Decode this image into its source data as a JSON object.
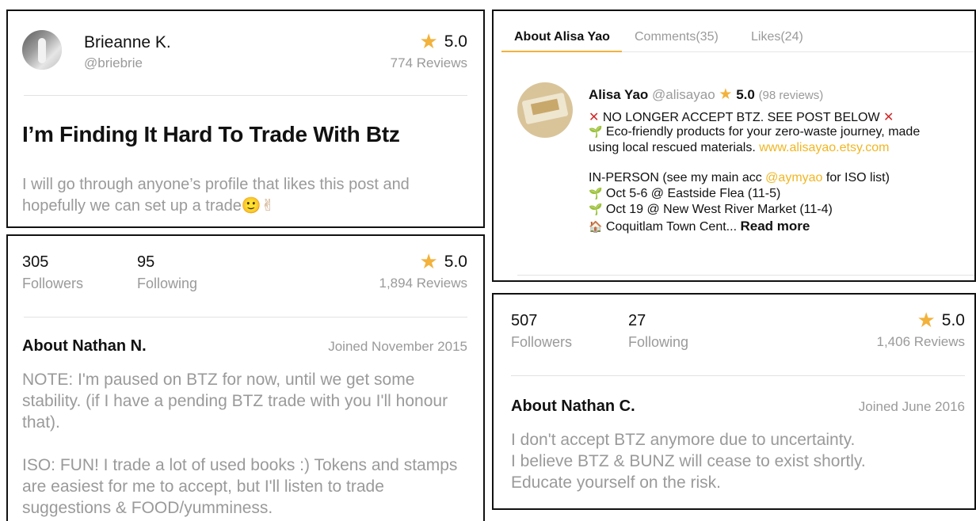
{
  "post": {
    "user_name": "Brieanne K.",
    "user_handle": "@briebrie",
    "rating": "5.0",
    "reviews": "774 Reviews",
    "title": "I’m Finding It Hard To Trade With Btz",
    "body": "I will go through anyone’s profile that likes this post and hopefully we can set up a trade",
    "emoji_1": "🙂",
    "emoji_2": "✌"
  },
  "profile_nathan_n": {
    "followers_count": "305",
    "followers_label": "Followers",
    "following_count": "95",
    "following_label": "Following",
    "rating": "5.0",
    "reviews": "1,894 Reviews",
    "about_title": "About Nathan N.",
    "joined": "Joined November 2015",
    "about_p1": "NOTE: I'm paused on BTZ for now, until we get some stability. (if I have a pending BTZ trade with you I'll honour that).",
    "about_p2": "ISO: FUN! I trade a lot of used books :) Tokens and stamps are easiest for me to accept, but I'll listen to trade suggestions & FOOD/yumminess."
  },
  "profile_alisa": {
    "tabs": [
      {
        "label": "About Alisa Yao"
      },
      {
        "label": "Comments(35)"
      },
      {
        "label": "Likes(24)"
      }
    ],
    "name": "Alisa Yao",
    "handle": "@alisayao",
    "rating": "5.0",
    "reviews": "(98 reviews)",
    "line_notice": "NO LONGER ACCEPT BTZ. SEE POST BELOW",
    "line_eco_1": "Eco-friendly products for your zero-waste journey, made",
    "line_eco_2": "using local rescued materials.",
    "site_link": "www.alisayao.etsy.com",
    "in_person_prefix": "IN-PERSON (see my main acc",
    "main_acc": "@aymyao",
    "in_person_suffix": "for ISO list)",
    "event_1": "Oct 5-6 @ Eastside Flea (11-5)",
    "event_2": "Oct 19 @ New West River Market (11-4)",
    "event_3": "Coquitlam Town Cent...",
    "read_more": "Read more",
    "icons": {
      "cross": "red-x-icon",
      "sprout": "seedling-icon",
      "house": "house-icon"
    }
  },
  "profile_nathan_c": {
    "followers_count": "507",
    "followers_label": "Followers",
    "following_count": "27",
    "following_label": "Following",
    "rating": "5.0",
    "reviews": "1,406 Reviews",
    "about_title": "About Nathan C.",
    "joined": "Joined June 2016",
    "about_l1": "I don't accept BTZ anymore due to uncertainty.",
    "about_l2": "I believe BTZ & BUNZ will cease to exist shortly.",
    "about_l3": "Educate yourself on the risk."
  },
  "colors": {
    "accent_star": "#f2b23b",
    "link": "#f0b623",
    "muted_text": "#9a9a9a",
    "cross": "#d12828"
  }
}
